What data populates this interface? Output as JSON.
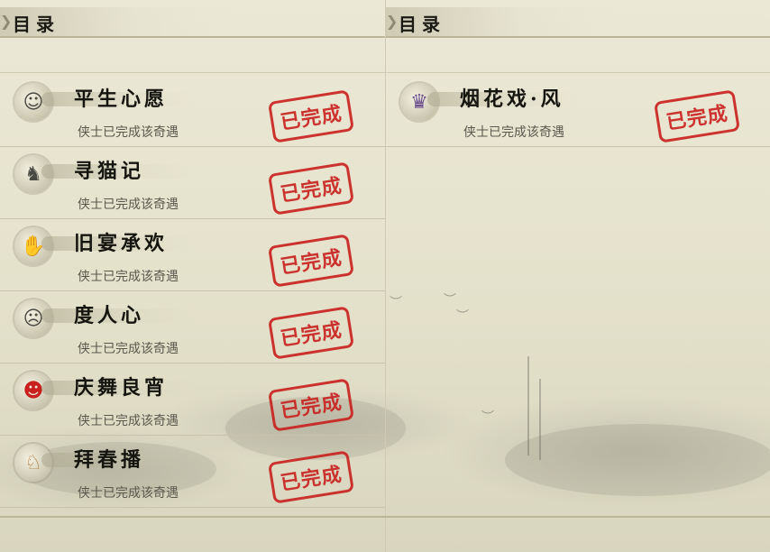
{
  "left_page": {
    "header": {
      "title": "目录"
    },
    "entries": [
      {
        "title": "平生心愿",
        "status": "侠士已完成该奇遇",
        "seal": "已完成",
        "icon": "scholar-icon"
      },
      {
        "title": "寻猫记",
        "status": "侠士已完成该奇遇",
        "seal": "已完成",
        "icon": "cat-icon"
      },
      {
        "title": "旧宴承欢",
        "status": "侠士已完成该奇遇",
        "seal": "已完成",
        "icon": "thumbs-up-icon"
      },
      {
        "title": "度人心",
        "status": "侠士已完成该奇遇",
        "seal": "已完成",
        "icon": "ghost-mask-icon"
      },
      {
        "title": "庆舞良宵",
        "status": "侠士已完成该奇遇",
        "seal": "已完成",
        "icon": "lion-dance-icon"
      },
      {
        "title": "拜春播",
        "status": "侠士已完成该奇遇",
        "seal": "已完成",
        "icon": "kangaroo-icon"
      }
    ]
  },
  "right_page": {
    "header": {
      "title": "目录"
    },
    "entries": [
      {
        "title": "烟花戏·风",
        "status": "侠士已完成该奇遇",
        "seal": "已完成",
        "icon": "swordswoman-icon"
      }
    ]
  },
  "colors": {
    "seal": "#c9201e",
    "paper": "#e6e3cf",
    "rule": "#bcb699"
  }
}
